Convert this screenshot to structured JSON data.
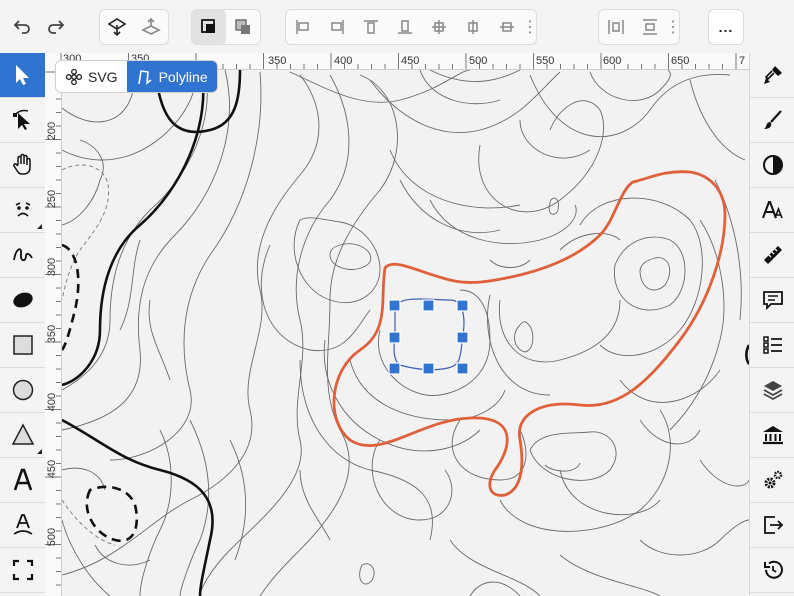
{
  "toolbar": {
    "more_label": "..."
  },
  "ruler": {
    "top_ticks": [
      "300",
      "350",
      "350",
      "400",
      "450",
      "500",
      "550",
      "600",
      "650",
      "7"
    ],
    "left_ticks": [
      "200",
      "250",
      "300",
      "350",
      "400",
      "450",
      "500"
    ]
  },
  "context": {
    "svg_label": "SVG",
    "polyline_label": "Polyline"
  },
  "colors": {
    "accent": "#2f74d0",
    "highlight_contour": "#e0603a",
    "handle": "#2f74d0"
  }
}
